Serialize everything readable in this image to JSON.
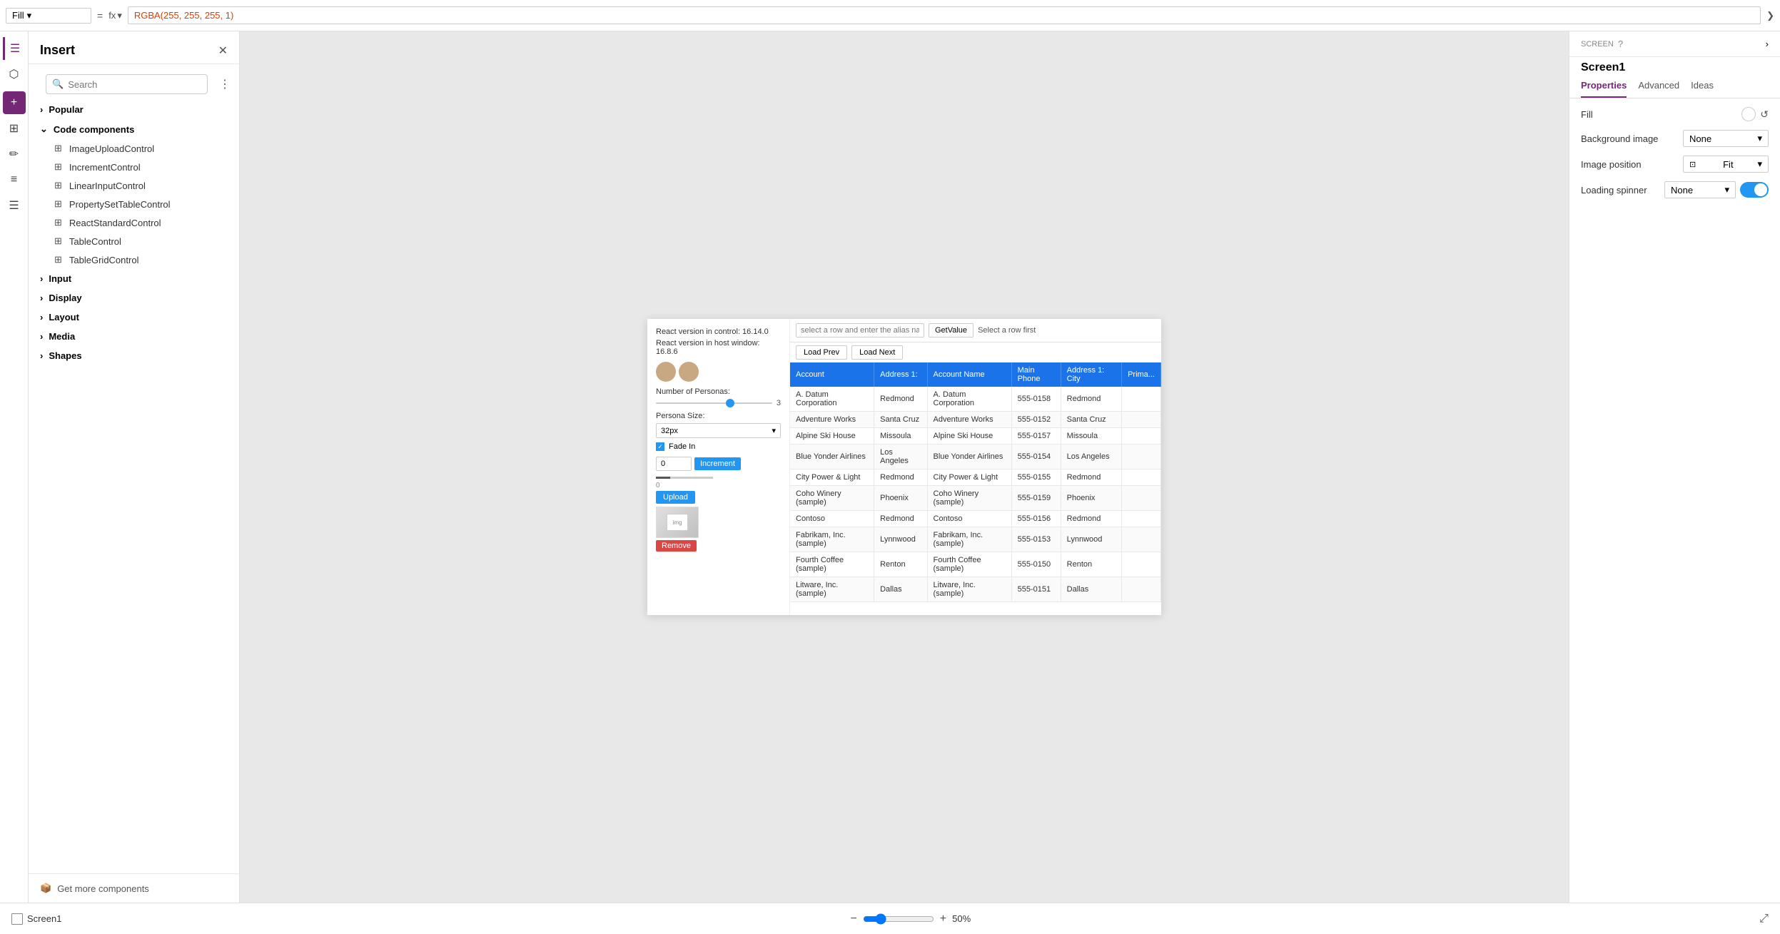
{
  "toolbar": {
    "fill_label": "Fill",
    "equals": "=",
    "fx": "fx",
    "formula": "RGBA(255, 255, 255, 1)"
  },
  "sidebar": {
    "icons": [
      "☰",
      "⬡",
      "+",
      "⊞",
      "✏",
      "≡",
      "☰"
    ]
  },
  "insert_panel": {
    "title": "Insert",
    "search_placeholder": "Search",
    "categories": [
      {
        "label": "Popular",
        "expanded": false
      },
      {
        "label": "Code components",
        "expanded": true,
        "items": [
          "ImageUploadControl",
          "IncrementControl",
          "LinearInputControl",
          "PropertySetTableControl",
          "ReactStandardControl",
          "TableControl",
          "TableGridControl"
        ]
      },
      {
        "label": "Input",
        "expanded": false
      },
      {
        "label": "Display",
        "expanded": false
      },
      {
        "label": "Layout",
        "expanded": false
      },
      {
        "label": "Media",
        "expanded": false
      },
      {
        "label": "Shapes",
        "expanded": false
      }
    ],
    "get_more": "Get more components"
  },
  "canvas": {
    "app_preview": {
      "react_version": "React version in control: 16.14.0",
      "react_host": "React version in host window: 16.8.6",
      "alias_placeholder": "select a row and enter the alias name",
      "get_value_btn": "GetValue",
      "select_row_hint": "Select a row first",
      "load_prev": "Load Prev",
      "load_next": "Load Next",
      "number_of_personas": "Number of Personas:",
      "persona_size_label": "Persona Size:",
      "persona_size_value": "32px",
      "fade_in_label": "Fade In",
      "num_input_value": "0",
      "increment_label": "Increment",
      "upload_label": "Upload",
      "remove_label": "Remove",
      "table_headers": [
        "Account",
        "Address 1:",
        "Account Name",
        "Main Phone",
        "Address 1: City",
        "Prima..."
      ],
      "table_rows": [
        [
          "A. Datum Corporation",
          "Redmond",
          "A. Datum Corporation",
          "555-0158",
          "Redmond",
          ""
        ],
        [
          "Adventure Works",
          "Santa Cruz",
          "Adventure Works",
          "555-0152",
          "Santa Cruz",
          ""
        ],
        [
          "Alpine Ski House",
          "Missoula",
          "Alpine Ski House",
          "555-0157",
          "Missoula",
          ""
        ],
        [
          "Blue Yonder Airlines",
          "Los Angeles",
          "Blue Yonder Airlines",
          "555-0154",
          "Los Angeles",
          ""
        ],
        [
          "City Power & Light",
          "Redmond",
          "City Power & Light",
          "555-0155",
          "Redmond",
          ""
        ],
        [
          "Coho Winery (sample)",
          "Phoenix",
          "Coho Winery (sample)",
          "555-0159",
          "Phoenix",
          ""
        ],
        [
          "Contoso",
          "Redmond",
          "Contoso",
          "555-0156",
          "Redmond",
          ""
        ],
        [
          "Fabrikam, Inc. (sample)",
          "Lynnwood",
          "Fabrikam, Inc. (sample)",
          "555-0153",
          "Lynnwood",
          ""
        ],
        [
          "Fourth Coffee (sample)",
          "Renton",
          "Fourth Coffee (sample)",
          "555-0150",
          "Renton",
          ""
        ],
        [
          "Litware, Inc. (sample)",
          "Dallas",
          "Litware, Inc. (sample)",
          "555-0151",
          "Dallas",
          ""
        ]
      ]
    }
  },
  "bottom_bar": {
    "screen_name": "Screen1",
    "zoom": "50",
    "zoom_pct": "%"
  },
  "right_panel": {
    "screen_label": "SCREEN",
    "screen_name": "Screen1",
    "tabs": [
      "Properties",
      "Advanced",
      "Ideas"
    ],
    "active_tab": "Properties",
    "fill_label": "Fill",
    "fill_value": "",
    "bg_image_label": "Background image",
    "bg_image_value": "None",
    "image_position_label": "Image position",
    "image_position_value": "Fit",
    "loading_spinner_label": "Loading spinner",
    "loading_spinner_value": "None"
  }
}
